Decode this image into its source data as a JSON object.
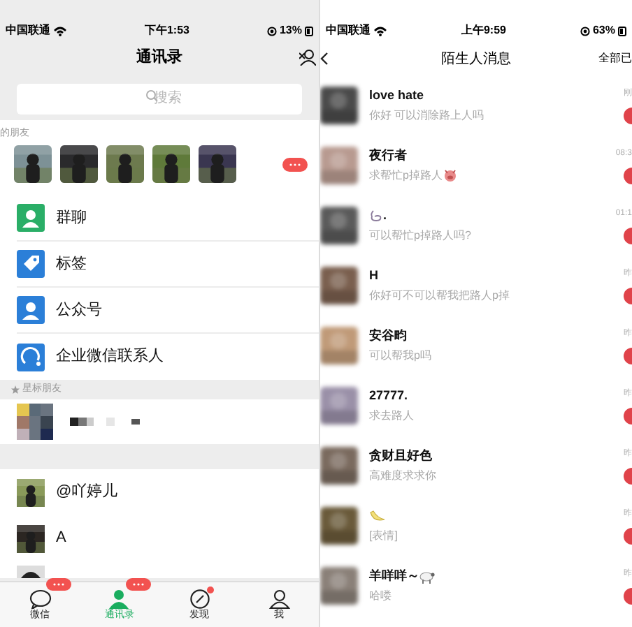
{
  "left": {
    "status_bar": {
      "carrier": "中国联通",
      "time": "下午1:53",
      "battery": "13%"
    },
    "title": "通讯录",
    "search": {
      "placeholder": "搜索"
    },
    "friends_label": "的朋友",
    "menu": [
      {
        "kind": "group",
        "label": "群聊"
      },
      {
        "kind": "tag",
        "label": "标签"
      },
      {
        "kind": "official",
        "label": "公众号"
      },
      {
        "kind": "work",
        "label": "企业微信联系人"
      }
    ],
    "section": "星标朋友",
    "contacts": [
      {
        "name": "@吖婷儿"
      },
      {
        "name": "A"
      }
    ],
    "tabs": [
      {
        "label": "微信",
        "kind": "chat",
        "selected": false,
        "badge": true
      },
      {
        "label": "通讯录",
        "kind": "contacts",
        "selected": true,
        "badge": true
      },
      {
        "label": "发现",
        "kind": "discover",
        "selected": false,
        "badge": true
      },
      {
        "label": "我",
        "kind": "me",
        "selected": false,
        "badge": false
      }
    ]
  },
  "right": {
    "status_bar": {
      "carrier": "中国联通",
      "time": "上午9:59",
      "battery": "63%"
    },
    "title": "陌生人消息",
    "action": "全部已",
    "messages": [
      {
        "kind": "plain",
        "name": "love hate",
        "preview": "你好 可以消除路上人吗",
        "time": "刚",
        "unread": true
      },
      {
        "kind": "pig",
        "name": "夜行者",
        "preview": "求帮忙p掉路人",
        "time": "08:3",
        "unread": true
      },
      {
        "kind": "ring",
        "name": ".",
        "preview": "可以帮忙p掉路人吗?",
        "time": "01:1",
        "unread": true
      },
      {
        "kind": "plain",
        "name": "H",
        "preview": "你好可不可以帮我把路人p掉",
        "time": "昨",
        "unread": true
      },
      {
        "kind": "plain",
        "name": "安谷畇",
        "preview": "可以帮我p吗",
        "time": "昨",
        "unread": true
      },
      {
        "kind": "plain",
        "name": "27777.",
        "preview": "求去路人",
        "time": "昨",
        "unread": true
      },
      {
        "kind": "plain",
        "name": "贪财且好色",
        "preview": "高难度求求你",
        "time": "昨",
        "unread": true
      },
      {
        "kind": "banana",
        "preview": "[表情]",
        "time": "昨",
        "unread": true
      },
      {
        "kind": "sheep",
        "name": "羊咩咩～",
        "preview": "哈喽",
        "time": "昨",
        "unread": true
      }
    ]
  }
}
